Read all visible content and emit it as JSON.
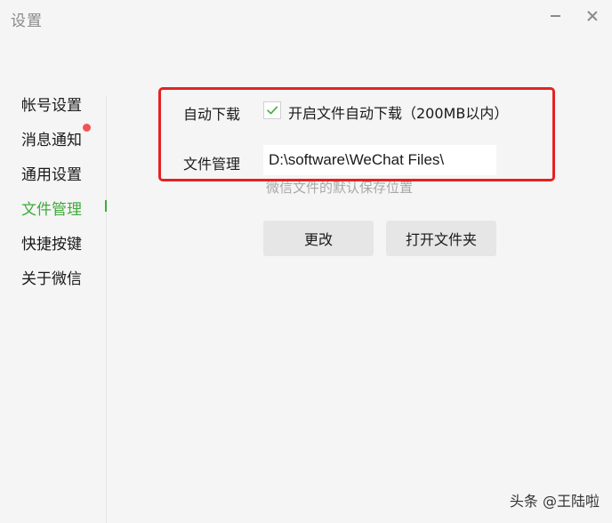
{
  "window": {
    "title": "设置",
    "minimize_icon": "minimize-icon",
    "close_icon": "close-icon"
  },
  "sidebar": {
    "items": [
      {
        "label": "帐号设置",
        "active": false,
        "badge": false
      },
      {
        "label": "消息通知",
        "active": false,
        "badge": true
      },
      {
        "label": "通用设置",
        "active": false,
        "badge": false
      },
      {
        "label": "文件管理",
        "active": true,
        "badge": false
      },
      {
        "label": "快捷按键",
        "active": false,
        "badge": false
      },
      {
        "label": "关于微信",
        "active": false,
        "badge": false
      }
    ]
  },
  "file_management": {
    "auto_download_label": "自动下载",
    "auto_download_checkbox_label": "开启文件自动下载（200MB以内）",
    "auto_download_checked": true,
    "file_management_label": "文件管理",
    "path_value": "D:\\software\\WeChat Files\\",
    "hint": "微信文件的默认保存位置",
    "change_button": "更改",
    "open_folder_button": "打开文件夹"
  },
  "watermark": "头条 @王陆啦",
  "colors": {
    "accent": "#3fab3a",
    "badge": "#f25353",
    "highlight": "#e52222"
  }
}
